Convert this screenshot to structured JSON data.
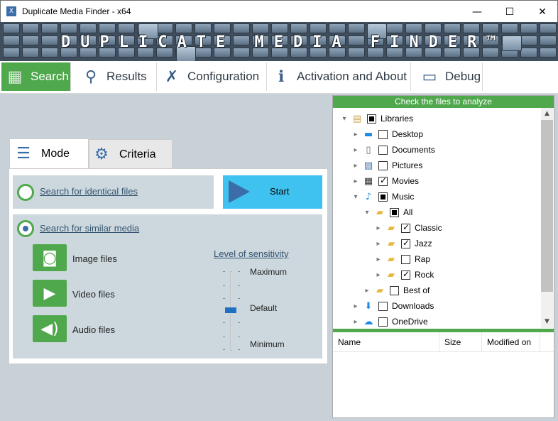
{
  "window": {
    "title": "Duplicate Media Finder - x64",
    "app_icon": "X",
    "min": "—",
    "max": "☐",
    "close": "✕"
  },
  "banner": {
    "text": "DUPLICATE MEDIA FINDER™"
  },
  "nav": [
    {
      "label": "Search",
      "icon": "grid-icon",
      "glyph": "▦",
      "active": true
    },
    {
      "label": "Results",
      "icon": "magnifier-icon",
      "glyph": "⚲"
    },
    {
      "label": "Configuration",
      "icon": "wrench-icon",
      "glyph": "✗"
    },
    {
      "label": "Activation and About",
      "icon": "info-icon",
      "glyph": "ℹ"
    },
    {
      "label": "Debug",
      "icon": "laptop-icon",
      "glyph": "▭"
    }
  ],
  "tabs": {
    "mode": "Mode",
    "criteria": "Criteria"
  },
  "mode": {
    "identical_label": "Search for identical files",
    "similar_label": "Search for similar media",
    "selected": "similar",
    "start_label": "Start",
    "file_types": [
      "Image files",
      "Video files",
      "Audio files"
    ],
    "sensitivity": {
      "title": "Level of sensitivity",
      "labels": {
        "max": "Maximum",
        "default": "Default",
        "min": "Minimum"
      },
      "value": 0.5
    }
  },
  "tree": {
    "header": "Check the files to analyze",
    "nodes": [
      {
        "label": "Libraries",
        "level": 0,
        "expanded": true,
        "state": "partial",
        "icon": "libraries-icon"
      },
      {
        "label": "Desktop",
        "level": 1,
        "expanded": false,
        "state": "unchecked",
        "icon": "desktop-icon"
      },
      {
        "label": "Documents",
        "level": 1,
        "expanded": false,
        "state": "unchecked",
        "icon": "documents-icon"
      },
      {
        "label": "Pictures",
        "level": 1,
        "expanded": false,
        "state": "unchecked",
        "icon": "pictures-icon"
      },
      {
        "label": "Movies",
        "level": 1,
        "expanded": false,
        "state": "checked",
        "icon": "movies-icon"
      },
      {
        "label": "Music",
        "level": 1,
        "expanded": true,
        "state": "partial",
        "icon": "music-icon"
      },
      {
        "label": "All",
        "level": 2,
        "expanded": true,
        "state": "partial",
        "icon": "folder-icon"
      },
      {
        "label": "Classic",
        "level": 3,
        "expanded": false,
        "state": "checked",
        "icon": "folder-icon"
      },
      {
        "label": "Jazz",
        "level": 3,
        "expanded": false,
        "state": "checked",
        "icon": "folder-icon"
      },
      {
        "label": "Rap",
        "level": 3,
        "expanded": false,
        "state": "unchecked",
        "icon": "folder-icon"
      },
      {
        "label": "Rock",
        "level": 3,
        "expanded": false,
        "state": "checked",
        "icon": "folder-icon"
      },
      {
        "label": "Best of",
        "level": 2,
        "expanded": false,
        "state": "unchecked",
        "icon": "folder-icon"
      },
      {
        "label": "Downloads",
        "level": 1,
        "expanded": false,
        "state": "unchecked",
        "icon": "downloads-icon"
      },
      {
        "label": "OneDrive",
        "level": 1,
        "expanded": false,
        "state": "unchecked",
        "icon": "cloud-icon"
      }
    ]
  },
  "file_list": {
    "columns": [
      "Name",
      "Size",
      "Modified on"
    ]
  },
  "colors": {
    "accent_green": "#4fa84c",
    "start_blue": "#3fc2ef",
    "dark_blue": "#3b6ea8"
  }
}
